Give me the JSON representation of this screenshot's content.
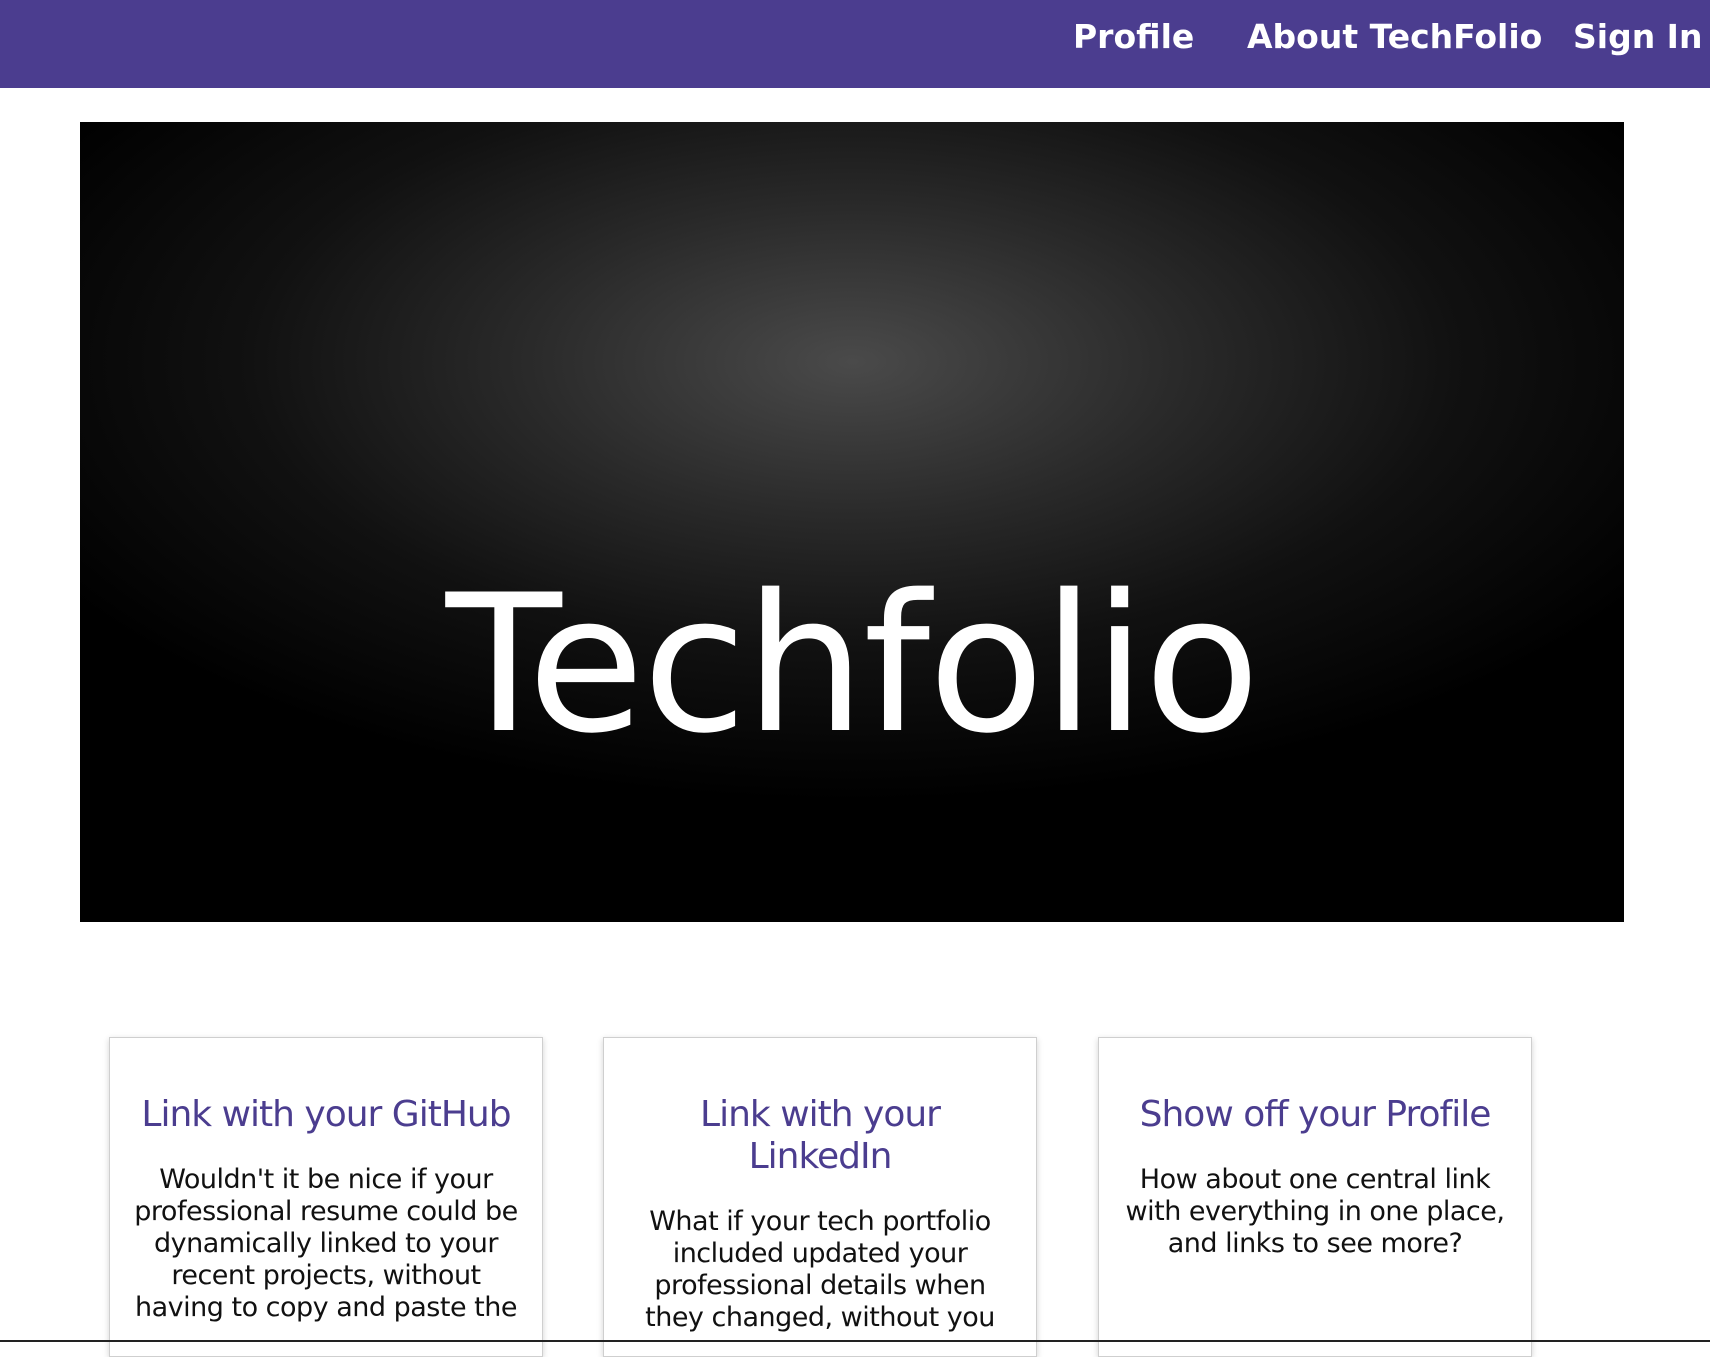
{
  "nav": {
    "links": [
      "Profile",
      "About TechFolio",
      "Sign In"
    ]
  },
  "hero": {
    "title": "Techfolio"
  },
  "cards": [
    {
      "title": "Link with your GitHub",
      "text": "Wouldn't it be nice if your professional resume could be dynamically linked to your recent projects, without having to copy and paste the"
    },
    {
      "title": "Link with your LinkedIn",
      "text": "What if your tech portfolio included updated your professional details when they changed, without you"
    },
    {
      "title": "Show off your Profile",
      "text": "How about one central link with everything in one place, and links to see more?"
    }
  ],
  "colors": {
    "navbar": "#4b3d8f",
    "accent": "#4b3d8f"
  }
}
